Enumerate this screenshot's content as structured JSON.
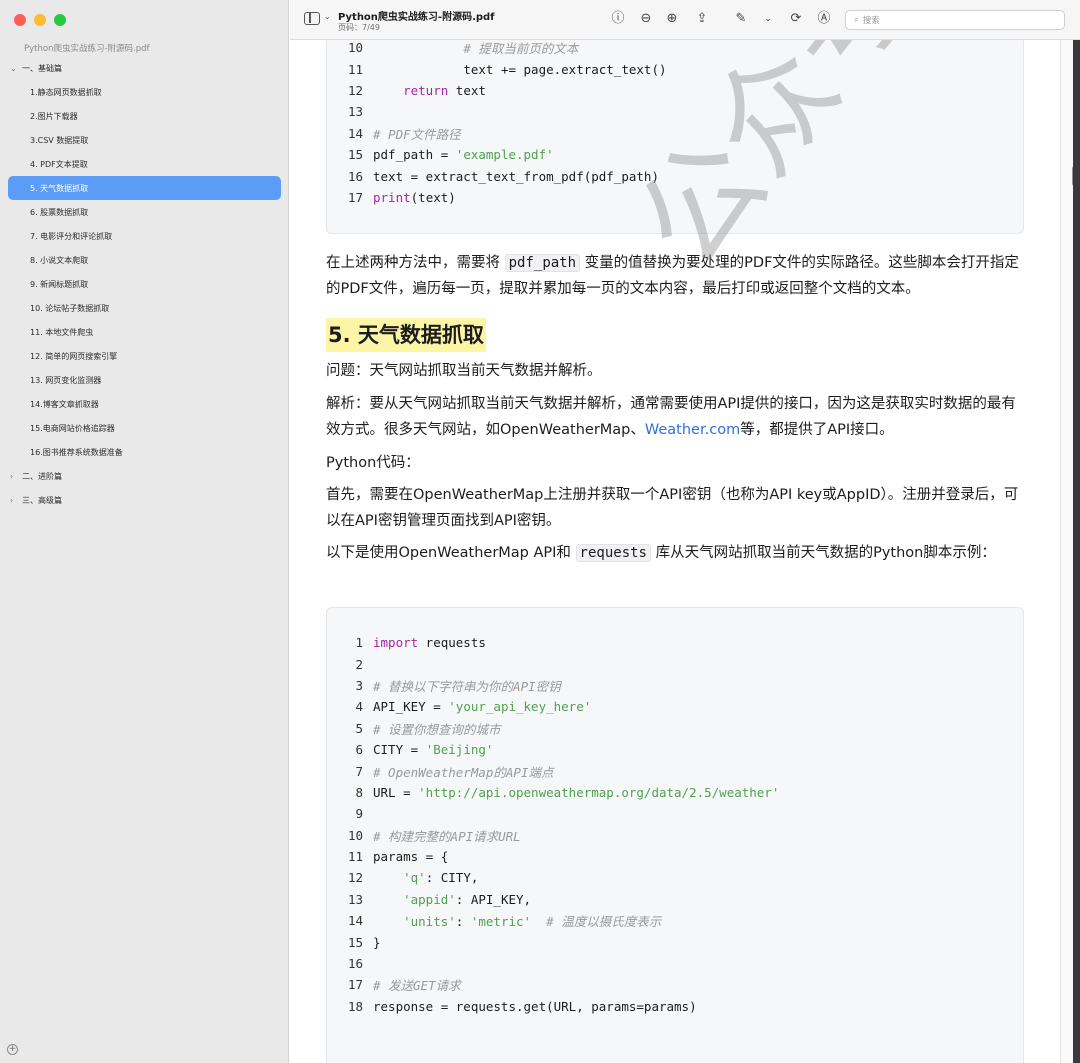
{
  "window": {
    "title": "Python爬虫实战练习-附源码.pdf",
    "subtitle": "页码：7/49"
  },
  "toolbar": {
    "search_placeholder": "搜索"
  },
  "sidebar": {
    "document_name": "Python爬虫实战练习-附源码.pdf",
    "sections": [
      {
        "label": "一、基础篇",
        "expanded": true
      },
      {
        "label": "二、进阶篇",
        "expanded": false
      },
      {
        "label": "三、高级篇",
        "expanded": false
      }
    ],
    "items": [
      "1.静态网页数据抓取",
      "2.图片下载器",
      "3.CSV 数据提取",
      "4. PDF文本提取",
      "5. 天气数据抓取",
      "6. 股票数据抓取",
      "7. 电影评分和评论抓取",
      "8. 小说文本爬取",
      "9. 新闻标题抓取",
      "10. 论坛帖子数据抓取",
      "11. 本地文件爬虫",
      "12. 简单的网页搜索引擎",
      "13. 网页变化监测器",
      "14.博客文章抓取器",
      "15.电商网站价格追踪器",
      "16.图书推荐系统数据准备"
    ],
    "selected_index": 4
  },
  "doc": {
    "code1": [
      {
        "n": "10",
        "indent": "            ",
        "parts": [
          [
            "cm",
            "# 提取当前页的文本"
          ]
        ]
      },
      {
        "n": "11",
        "indent": "            ",
        "parts": [
          [
            "",
            "text += page.extract_text()"
          ]
        ]
      },
      {
        "n": "12",
        "indent": "    ",
        "parts": [
          [
            "kw",
            "return"
          ],
          [
            "",
            " text"
          ]
        ]
      },
      {
        "n": "13",
        "indent": "",
        "parts": []
      },
      {
        "n": "14",
        "indent": "",
        "parts": [
          [
            "cm",
            "# PDF文件路径"
          ]
        ]
      },
      {
        "n": "15",
        "indent": "",
        "parts": [
          [
            "",
            "pdf_path = "
          ],
          [
            "st",
            "'example.pdf'"
          ]
        ]
      },
      {
        "n": "16",
        "indent": "",
        "parts": [
          [
            "",
            "text = extract_text_from_pdf(pdf_path)"
          ]
        ]
      },
      {
        "n": "17",
        "indent": "",
        "parts": [
          [
            "fn",
            "print"
          ],
          [
            "",
            "(text)"
          ]
        ]
      }
    ],
    "para1_a": "在上述两种方法中，需要将 ",
    "para1_code": "pdf_path",
    "para1_b": " 变量的值替换为要处理的PDF文件的实际路径。这些脚本会打开指定的PDF文件，遍历每一页，提取并累加每一页的文本内容，最后打印或返回整个文档的文本。",
    "heading": "5. 天气数据抓取",
    "question": "问题：天气网站抓取当前天气数据并解析。",
    "analysis_a": "解析：要从天气网站抓取当前天气数据并解析，通常需要使用API提供的接口，因为这是获取实时数据的最有效方式。很多天气网站，如OpenWeatherMap、",
    "analysis_link": "Weather.com",
    "analysis_b": "等，都提供了API接口。",
    "python_code_label": "Python代码：",
    "first_para": "首先，需要在OpenWeatherMap上注册并获取一个API密钥（也称为API key或AppID）。注册并登录后，可以在API密钥管理页面找到API密钥。",
    "below_a": "以下是使用OpenWeatherMap API和 ",
    "below_code": "requests",
    "below_b": " 库从天气网站抓取当前天气数据的Python脚本示例：",
    "code2": [
      {
        "n": "1",
        "indent": "",
        "parts": [
          [
            "kw",
            "import"
          ],
          [
            "",
            " requests"
          ]
        ]
      },
      {
        "n": "2",
        "indent": "",
        "parts": []
      },
      {
        "n": "3",
        "indent": "",
        "parts": [
          [
            "cm",
            "# 替换以下字符串为你的API密钥"
          ]
        ]
      },
      {
        "n": "4",
        "indent": "",
        "parts": [
          [
            "",
            "API_KEY = "
          ],
          [
            "st",
            "'your_api_key_here'"
          ]
        ]
      },
      {
        "n": "5",
        "indent": "",
        "parts": [
          [
            "cm",
            "# 设置你想查询的城市"
          ]
        ]
      },
      {
        "n": "6",
        "indent": "",
        "parts": [
          [
            "",
            "CITY = "
          ],
          [
            "st",
            "'Beijing'"
          ]
        ]
      },
      {
        "n": "7",
        "indent": "",
        "parts": [
          [
            "cm",
            "# OpenWeatherMap的API端点"
          ]
        ]
      },
      {
        "n": "8",
        "indent": "",
        "parts": [
          [
            "",
            "URL = "
          ],
          [
            "st",
            "'http://api.openweathermap.org/data/2.5/weather'"
          ]
        ]
      },
      {
        "n": "9",
        "indent": "",
        "parts": []
      },
      {
        "n": "10",
        "indent": "",
        "parts": [
          [
            "cm",
            "# 构建完整的API请求URL"
          ]
        ]
      },
      {
        "n": "11",
        "indent": "",
        "parts": [
          [
            "",
            "params = {"
          ]
        ]
      },
      {
        "n": "12",
        "indent": "    ",
        "parts": [
          [
            "st",
            "'q'"
          ],
          [
            "",
            ": CITY,"
          ]
        ]
      },
      {
        "n": "13",
        "indent": "    ",
        "parts": [
          [
            "st",
            "'appid'"
          ],
          [
            "",
            ": API_KEY,"
          ]
        ]
      },
      {
        "n": "14",
        "indent": "    ",
        "parts": [
          [
            "st",
            "'units'"
          ],
          [
            "",
            ": "
          ],
          [
            "st",
            "'metric'"
          ],
          [
            "",
            "  "
          ],
          [
            "cm",
            "# 温度以摄氏度表示"
          ]
        ]
      },
      {
        "n": "15",
        "indent": "",
        "parts": [
          [
            "",
            "}"
          ]
        ]
      },
      {
        "n": "16",
        "indent": "",
        "parts": []
      },
      {
        "n": "17",
        "indent": "",
        "parts": [
          [
            "cm",
            "# 发送GET请求"
          ]
        ]
      },
      {
        "n": "18",
        "indent": "",
        "parts": [
          [
            "",
            "response = requests.get(URL, params=params)"
          ]
        ]
      }
    ]
  },
  "watermark": "公众号涛哥聊Python",
  "colors": {
    "selected_bg": "#5b9cf6",
    "highlight": "#fdf5a6",
    "keyword": "#a626a4",
    "string": "#50a14f",
    "comment": "#9a9a9a",
    "link": "#2f6fde"
  }
}
